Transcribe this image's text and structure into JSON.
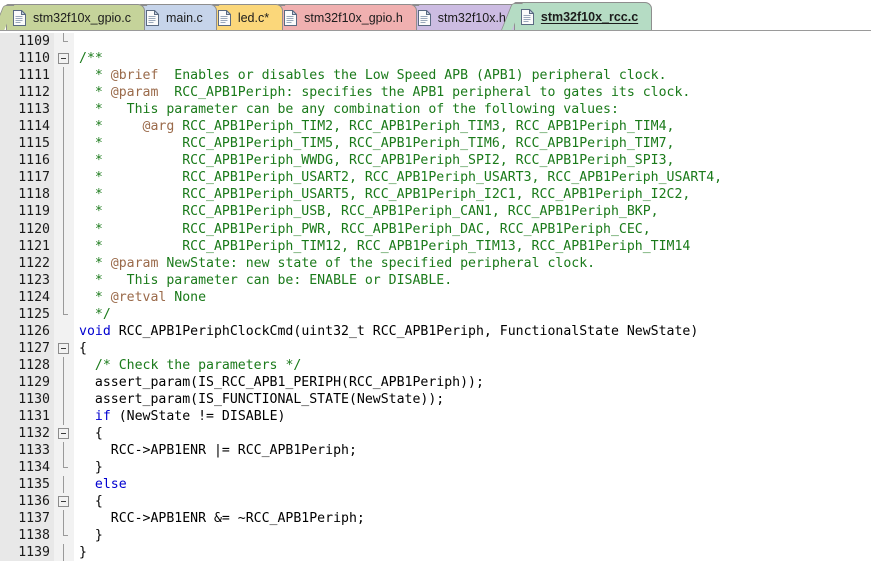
{
  "window": {
    "app": "code-editor",
    "colors": {
      "comment": "#1a7a1a",
      "doc_tag": "#9a6a4a",
      "keyword": "#0000d0",
      "plain": "#000000",
      "gutter_bg": "#e8e8e8",
      "fold_bg": "#f2f2f2",
      "editor_bg": "#ffffff"
    }
  },
  "tabbar": {
    "tabs": [
      {
        "label": "stm32f10x_gpio.c",
        "color": "#c5d39a",
        "active": false,
        "modified": false,
        "icon": "document-icon"
      },
      {
        "label": "main.c",
        "color": "#c6d4ea",
        "active": false,
        "modified": false,
        "icon": "document-icon"
      },
      {
        "label": "led.c*",
        "color": "#fbd77a",
        "active": false,
        "modified": true,
        "icon": "document-icon"
      },
      {
        "label": "stm32f10x_gpio.h",
        "color": "#f0b0b0",
        "active": false,
        "modified": false,
        "icon": "document-icon"
      },
      {
        "label": "stm32f10x.h",
        "color": "#ccbce2",
        "active": false,
        "modified": false,
        "icon": "document-icon"
      },
      {
        "label": "stm32f10x_rcc.c",
        "color": "#b5dcc4",
        "active": true,
        "modified": false,
        "icon": "document-icon"
      }
    ]
  },
  "editor": {
    "first_line": 1109,
    "lines": [
      {
        "n": 1109,
        "fold": "end",
        "segments": []
      },
      {
        "n": 1110,
        "fold": "box",
        "segments": [
          {
            "t": "/**",
            "c": "cmt"
          }
        ]
      },
      {
        "n": 1111,
        "fold": "line",
        "segments": [
          {
            "t": "  * ",
            "c": "cmt"
          },
          {
            "t": "@brief",
            "c": "tag"
          },
          {
            "t": "  Enables or disables the Low Speed APB (APB1) peripheral clock.",
            "c": "cmt"
          }
        ]
      },
      {
        "n": 1112,
        "fold": "line",
        "segments": [
          {
            "t": "  * ",
            "c": "cmt"
          },
          {
            "t": "@param",
            "c": "tag"
          },
          {
            "t": "  RCC_APB1Periph: specifies the APB1 peripheral to gates its clock.",
            "c": "cmt"
          }
        ]
      },
      {
        "n": 1113,
        "fold": "line",
        "segments": [
          {
            "t": "  *   This parameter can be any combination of the following values:",
            "c": "cmt"
          }
        ]
      },
      {
        "n": 1114,
        "fold": "line",
        "segments": [
          {
            "t": "  *     ",
            "c": "cmt"
          },
          {
            "t": "@arg",
            "c": "tag"
          },
          {
            "t": " RCC_APB1Periph_TIM2, RCC_APB1Periph_TIM3, RCC_APB1Periph_TIM4,",
            "c": "cmt"
          }
        ]
      },
      {
        "n": 1115,
        "fold": "line",
        "segments": [
          {
            "t": "  *          RCC_APB1Periph_TIM5, RCC_APB1Periph_TIM6, RCC_APB1Periph_TIM7,",
            "c": "cmt"
          }
        ]
      },
      {
        "n": 1116,
        "fold": "line",
        "segments": [
          {
            "t": "  *          RCC_APB1Periph_WWDG, RCC_APB1Periph_SPI2, RCC_APB1Periph_SPI3,",
            "c": "cmt"
          }
        ]
      },
      {
        "n": 1117,
        "fold": "line",
        "segments": [
          {
            "t": "  *          RCC_APB1Periph_USART2, RCC_APB1Periph_USART3, RCC_APB1Periph_USART4,",
            "c": "cmt"
          }
        ]
      },
      {
        "n": 1118,
        "fold": "line",
        "segments": [
          {
            "t": "  *          RCC_APB1Periph_USART5, RCC_APB1Periph_I2C1, RCC_APB1Periph_I2C2,",
            "c": "cmt"
          }
        ]
      },
      {
        "n": 1119,
        "fold": "line",
        "segments": [
          {
            "t": "  *          RCC_APB1Periph_USB, RCC_APB1Periph_CAN1, RCC_APB1Periph_BKP,",
            "c": "cmt"
          }
        ]
      },
      {
        "n": 1120,
        "fold": "line",
        "segments": [
          {
            "t": "  *          RCC_APB1Periph_PWR, RCC_APB1Periph_DAC, RCC_APB1Periph_CEC,",
            "c": "cmt"
          }
        ]
      },
      {
        "n": 1121,
        "fold": "line",
        "segments": [
          {
            "t": "  *          RCC_APB1Periph_TIM12, RCC_APB1Periph_TIM13, RCC_APB1Periph_TIM14",
            "c": "cmt"
          }
        ]
      },
      {
        "n": 1122,
        "fold": "line",
        "segments": [
          {
            "t": "  * ",
            "c": "cmt"
          },
          {
            "t": "@param",
            "c": "tag"
          },
          {
            "t": " NewState: new state of the specified peripheral clock.",
            "c": "cmt"
          }
        ]
      },
      {
        "n": 1123,
        "fold": "line",
        "segments": [
          {
            "t": "  *   This parameter can be: ENABLE or DISABLE.",
            "c": "cmt"
          }
        ]
      },
      {
        "n": 1124,
        "fold": "line",
        "segments": [
          {
            "t": "  * ",
            "c": "cmt"
          },
          {
            "t": "@retval",
            "c": "tag"
          },
          {
            "t": " None",
            "c": "cmt"
          }
        ]
      },
      {
        "n": 1125,
        "fold": "end",
        "segments": [
          {
            "t": "  */",
            "c": "cmt"
          }
        ]
      },
      {
        "n": 1126,
        "fold": "none",
        "segments": [
          {
            "t": "void",
            "c": "kw"
          },
          {
            "t": " RCC_APB1PeriphClockCmd(uint32_t RCC_APB1Periph, FunctionalState NewState)",
            "c": "plain"
          }
        ]
      },
      {
        "n": 1127,
        "fold": "box",
        "segments": [
          {
            "t": "{",
            "c": "plain"
          }
        ]
      },
      {
        "n": 1128,
        "fold": "line",
        "segments": [
          {
            "t": "  ",
            "c": "plain"
          },
          {
            "t": "/* Check the parameters */",
            "c": "cmt"
          }
        ]
      },
      {
        "n": 1129,
        "fold": "line",
        "segments": [
          {
            "t": "  assert_param(IS_RCC_APB1_PERIPH(RCC_APB1Periph));",
            "c": "plain"
          }
        ]
      },
      {
        "n": 1130,
        "fold": "line",
        "segments": [
          {
            "t": "  assert_param(IS_FUNCTIONAL_STATE(NewState));",
            "c": "plain"
          }
        ]
      },
      {
        "n": 1131,
        "fold": "line",
        "segments": [
          {
            "t": "  ",
            "c": "plain"
          },
          {
            "t": "if",
            "c": "kw"
          },
          {
            "t": " (NewState != DISABLE)",
            "c": "plain"
          }
        ]
      },
      {
        "n": 1132,
        "fold": "box",
        "segments": [
          {
            "t": "  {",
            "c": "plain"
          }
        ]
      },
      {
        "n": 1133,
        "fold": "line",
        "segments": [
          {
            "t": "    RCC->APB1ENR |= RCC_APB1Periph;",
            "c": "plain"
          }
        ]
      },
      {
        "n": 1134,
        "fold": "end",
        "segments": [
          {
            "t": "  }",
            "c": "plain"
          }
        ]
      },
      {
        "n": 1135,
        "fold": "line",
        "segments": [
          {
            "t": "  ",
            "c": "plain"
          },
          {
            "t": "else",
            "c": "kw"
          }
        ]
      },
      {
        "n": 1136,
        "fold": "box",
        "segments": [
          {
            "t": "  {",
            "c": "plain"
          }
        ]
      },
      {
        "n": 1137,
        "fold": "line",
        "segments": [
          {
            "t": "    RCC->APB1ENR &= ~RCC_APB1Periph;",
            "c": "plain"
          }
        ]
      },
      {
        "n": 1138,
        "fold": "end",
        "segments": [
          {
            "t": "  }",
            "c": "plain"
          }
        ]
      },
      {
        "n": 1139,
        "fold": "line",
        "segments": [
          {
            "t": "}",
            "c": "plain"
          }
        ]
      }
    ]
  }
}
